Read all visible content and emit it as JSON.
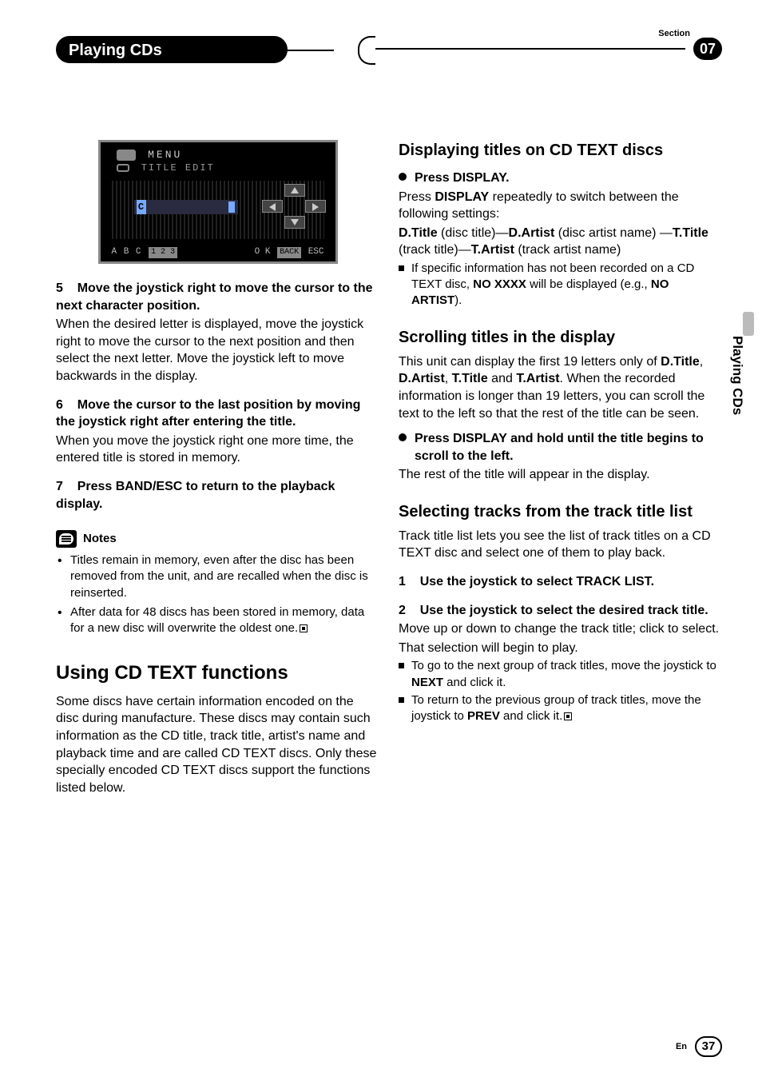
{
  "header": {
    "chapter_title": "Playing CDs",
    "section_label": "Section",
    "section_number": "07"
  },
  "side_tab": "Playing CDs",
  "lcd": {
    "menu": "MENU",
    "sub": "TITLE EDIT",
    "c": "C",
    "abc": "A B C",
    "nums": "1 2 3",
    "ok": "O K",
    "back": "BACK",
    "esc": "ESC"
  },
  "left": {
    "step5": {
      "num": "5",
      "title": "Move the joystick right to move the cursor to the next character position.",
      "body": "When the desired letter is displayed, move the joystick right to move the cursor to the next position and then select the next letter. Move the joystick left to move backwards in the display."
    },
    "step6": {
      "num": "6",
      "title": "Move the cursor to the last position by moving the joystick right after entering the title.",
      "body": "When you move the joystick right one more time, the entered title is stored in memory."
    },
    "step7": {
      "num": "7",
      "title": "Press BAND/ESC to return to the playback display."
    },
    "notes_label": "Notes",
    "notes": [
      "Titles remain in memory, even after the disc has been removed from the unit, and are recalled when the disc is reinserted.",
      "After data for 48 discs has been stored in memory, data for a new disc will overwrite the oldest one."
    ],
    "h1": "Using CD TEXT functions",
    "h1_body": "Some discs have certain information encoded on the disc during manufacture. These discs may contain such information as the CD title, track title, artist's name and playback time and are called CD TEXT discs. Only these specially encoded CD TEXT discs support the functions listed below."
  },
  "right": {
    "h2a": "Displaying titles on CD TEXT discs",
    "a_bullet": "Press DISPLAY.",
    "a_body1_pre": "Press ",
    "a_body1_b": "DISPLAY",
    "a_body1_post": " repeatedly to switch between the following settings:",
    "a_body2_parts": {
      "p1": "D.Title",
      "t1": " (disc title)—",
      "p2": "D.Artist",
      "t2": " (disc artist name) —",
      "p3": "T.Title",
      "t3": " (track title)—",
      "p4": "T.Artist",
      "t4": " (track artist name)"
    },
    "a_sq1_pre": "If specific information has not been recorded on a CD TEXT disc, ",
    "a_sq1_b1": "NO XXXX",
    "a_sq1_mid": " will be displayed (e.g., ",
    "a_sq1_b2": "NO ARTIST",
    "a_sq1_post": ").",
    "h2b": "Scrolling titles in the display",
    "b_body_pre": "This unit can display the first 19 letters only of ",
    "b_b1": "D.Title",
    "b_c1": ", ",
    "b_b2": "D.Artist",
    "b_c2": ", ",
    "b_b3": "T.Title",
    "b_c3": " and ",
    "b_b4": "T.Artist",
    "b_body_post": ". When the recorded information is longer than 19 letters, you can scroll the text to the left so that the rest of the title can be seen.",
    "b_bullet": "Press DISPLAY and hold until the title begins to scroll to the left.",
    "b_after": "The rest of the title will appear in the display.",
    "h2c": "Selecting tracks from the track title list",
    "c_body": "Track title list lets you see the list of track titles on a CD TEXT disc and select one of them to play back.",
    "c_step1": {
      "num": "1",
      "title": "Use the joystick to select TRACK LIST."
    },
    "c_step2": {
      "num": "2",
      "title": "Use the joystick to select the desired track title.",
      "body": "Move up or down to change the track title; click to select.",
      "body2": "That selection will begin to play."
    },
    "c_sq1_pre": "To go to the next group of track titles, move the joystick to ",
    "c_sq1_b": "NEXT",
    "c_sq1_post": " and click it.",
    "c_sq2_pre": "To return to the previous group of track titles, move the joystick to ",
    "c_sq2_b": "PREV",
    "c_sq2_post": " and click it."
  },
  "footer": {
    "lang": "En",
    "page": "37"
  }
}
